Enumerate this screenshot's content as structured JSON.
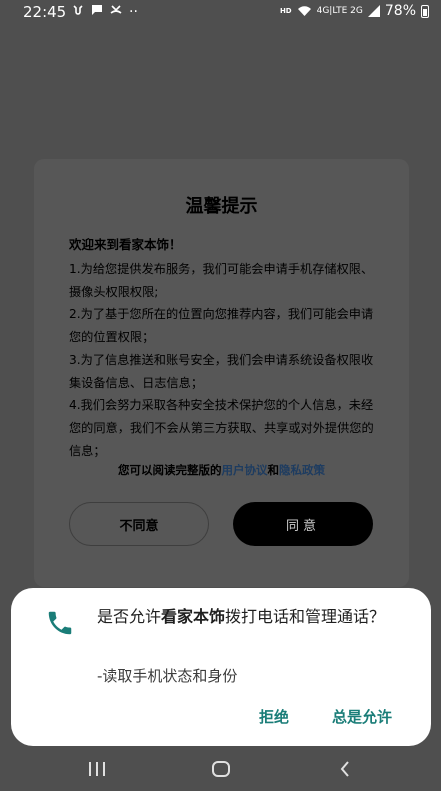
{
  "status_bar": {
    "time": "22:45",
    "hd": "HD",
    "signal": "4G|LTE 2G",
    "battery": "78%",
    "dots": "··"
  },
  "dialog": {
    "title": "温馨提示",
    "welcome": "欢迎来到看家本饰！",
    "items": [
      "1.为给您提供发布服务，我们可能会申请手机存储权限、 摄像头权限权限;",
      "2.为了基于您所在的位置向您推荐内容，我们可能会申请您的位置权限；",
      "3.为了信息推送和账号安全，我们会申请系统设备权限收集设备信息、日志信息；",
      "4.我们会努力采取各种安全技术保护您的个人信息，未经您的同意，我们不会从第三方获取、共享或对外提供您的信息；"
    ],
    "policy_prefix": "您可以阅读完整版的",
    "user_agreement": "用户协议",
    "policy_and": "和",
    "privacy_policy": "隐私政策",
    "disagree": "不同意",
    "agree": "同意"
  },
  "permission": {
    "question_prefix": "是否允许",
    "app_name": "看家本饰",
    "question_suffix": "拨打电话和管理通话？",
    "detail": "-读取手机状态和身份",
    "deny": "拒绝",
    "allow": "总是允许",
    "accent": "#1a7d78"
  }
}
